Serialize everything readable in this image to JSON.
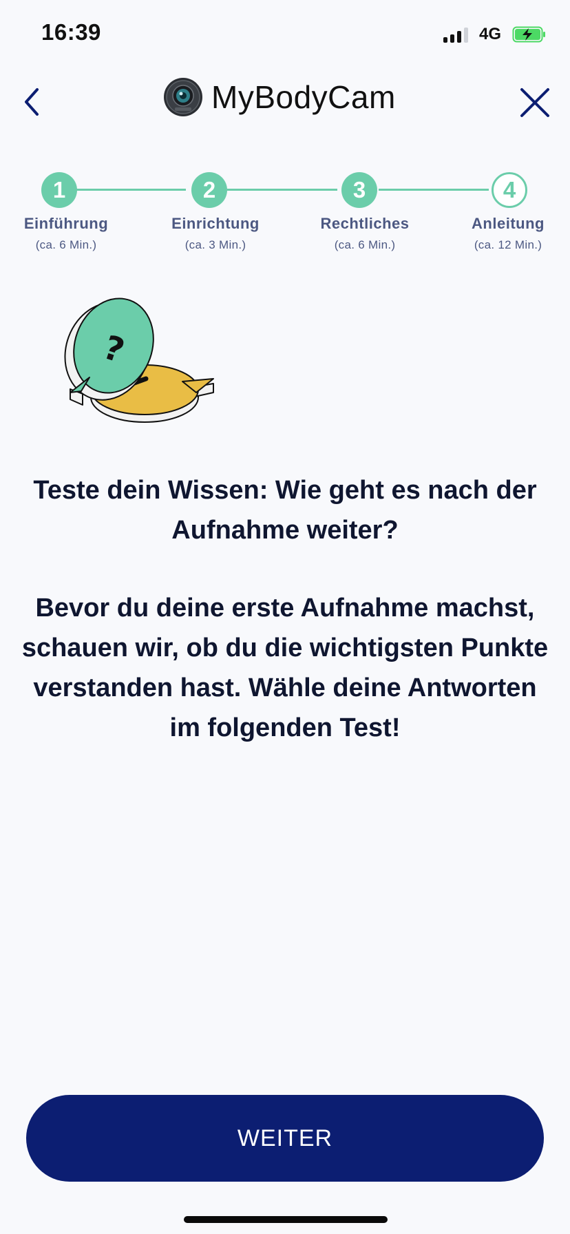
{
  "status_bar": {
    "time": "16:39",
    "network": "4G",
    "icons": [
      "signal-icon",
      "battery-charging-icon"
    ],
    "battery_color": "#4cd964"
  },
  "header": {
    "title": "MyBodyCam",
    "logo_text": "MyBodyCam",
    "back_icon": "chevron-left-icon",
    "close_icon": "close-icon",
    "icon_color": "#0c1e72"
  },
  "stepper": {
    "accent_color": "#6bcdaa",
    "steps": [
      {
        "number": "1",
        "label": "Einführung",
        "duration": "(ca. 6 Min.)",
        "state": "done"
      },
      {
        "number": "2",
        "label": "Einrichtung",
        "duration": "(ca. 3 Min.)",
        "state": "done"
      },
      {
        "number": "3",
        "label": "Rechtliches",
        "duration": "(ca. 6 Min.)",
        "state": "done"
      },
      {
        "number": "4",
        "label": "Anleitung",
        "duration": "(ca. 12 Min.)",
        "state": "open"
      }
    ]
  },
  "illustration": {
    "icon": "question-exclamation-bubbles-icon",
    "colors": {
      "question": "#6bcdaa",
      "exclamation": "#e9bd45"
    }
  },
  "content": {
    "heading": "Teste dein Wissen: Wie geht es nach der Aufnahme weiter?",
    "body": "Bevor du deine erste Aufnahme machst, schauen wir, ob du die wichtigsten Punkte verstanden hast. Wähle deine Antworten im folgenden Test!"
  },
  "footer": {
    "cta_label": "WEITER",
    "cta_color": "#0c1e72"
  }
}
